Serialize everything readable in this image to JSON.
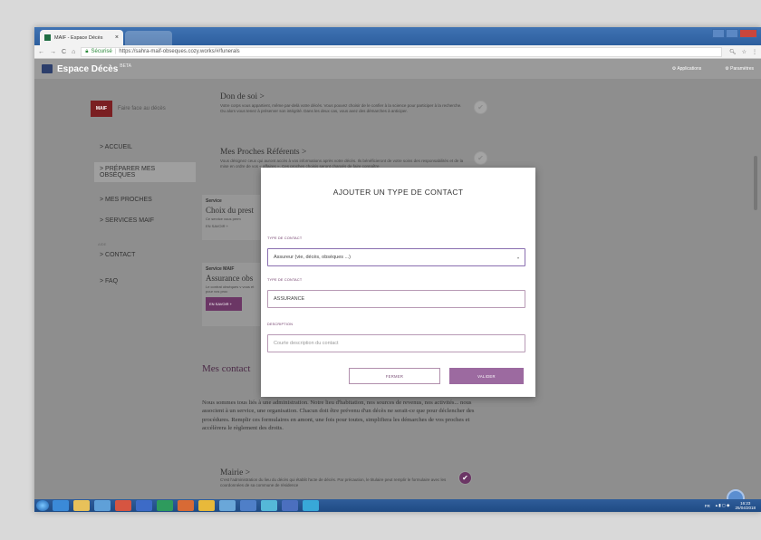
{
  "browser": {
    "tab_title": "MAIF - Espace Décès",
    "tab_close": "×",
    "secure_label": "Sécurisé",
    "url": "https://sahra-maif-obseques.cozy.works/#/funerals"
  },
  "app": {
    "title": "Espace Décès",
    "beta": "BETA",
    "applications": "Applications",
    "parametres": "Paramètres"
  },
  "sidebar": {
    "slogan": "Faire face au décès",
    "maif": "MAIF",
    "items": [
      {
        "label": "ACCUEIL"
      },
      {
        "label": "PRÉPARER MES OBSÈQUES"
      },
      {
        "label": "MES PROCHES"
      },
      {
        "label": "SERVICES MAIF"
      },
      {
        "label": "CONTACT"
      },
      {
        "label": "FAQ"
      }
    ],
    "separator": "AIDE"
  },
  "content": {
    "don_title": "Don de soi >",
    "don_text": "Votre corps vous appartient, même par-delà votre décès. Vous pouvez choisir de le confier à la science pour participer à la recherche. Ou alors vous tenez à préserver son intégrité. Dans les deux cas, vous avez des démarches à anticiper.",
    "proches_title": "Mes Proches Référents >",
    "proches_text": "Vous désignez ceux qui auront accès à vos informations après votre décès. Ils bénéficieront de votre soins des responsabilités et de la mise en ordre de vos « affaires ». Ces proches choisis seront chargés de faire connaître",
    "service1_label": "Service",
    "service1_title": "Choix du prest",
    "service1_text": "Ce service vous perm",
    "service1_more": "EN SAVOIR +",
    "service2_label": "Service MAIF",
    "service2_title": "Assurance obs",
    "service2_text": "Le contrat obsèques v vous et pour vos proc",
    "service2_btn": "EN SAVOIR +",
    "contacts_title": "Mes contact",
    "contacts_para": "Nous sommes tous liés à une administration. Notre lieu d'habitation, nos sources de revenus, nos activités... nous associent à un service, une organisation. Chacun doit être prévenu d'un décès ne serait-ce que pour déclencher des procédures. Remplir ces formulaires en amont, une fois pour toutes, simplifiera les démarches de vos proches et accélèrera le règlement des droits.",
    "mairie_title": "Mairie >",
    "mairie_text": "C'est l'administration du lieu du décès qui établit l'acte de décès. Par précaution, le titulaire peut remplir le formulaire avec les coordonnées de sa commune de résidence"
  },
  "modal": {
    "title": "AJOUTER UN TYPE DE CONTACT",
    "label_type1": "TYPE DE CONTACT",
    "select_value": "Assureur (vie, décès, obsèques ...)",
    "label_type2": "TYPE DE CONTACT",
    "type_value": "ASSURANCE",
    "label_desc": "DESCRIPTION",
    "desc_placeholder": "Courte description du contact",
    "cancel": "FERMER",
    "ok": "VALIDER"
  },
  "taskbar": {
    "lang": "FR",
    "time": "16:23",
    "date": "25/04/2018"
  },
  "colors": {
    "accent": "#6b3665",
    "modal_btn": "#9c6aa0"
  }
}
